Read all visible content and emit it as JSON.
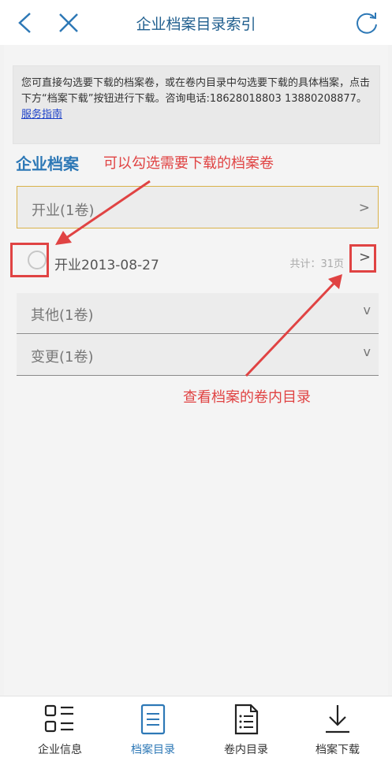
{
  "header": {
    "title": "企业档案目录索引"
  },
  "notice": {
    "text": "您可直接勾选要下载的档案卷，或在卷内目录中勾选要下载的具体档案，点击下方“档案下载”按钮进行下载。咨询电话:18628018803 13880208877。",
    "link": "服务指南"
  },
  "section": {
    "title": "企业档案"
  },
  "annotations": {
    "select_hint": "可以勾选需要下载的档案卷",
    "view_hint": "查看档案的卷内目录"
  },
  "groups": [
    {
      "label": "开业(1卷)",
      "arrow": ">"
    },
    {
      "label": "其他(1卷)",
      "arrow": "v"
    },
    {
      "label": "变更(1卷)",
      "arrow": "v"
    }
  ],
  "item": {
    "label": "开业2013-08-27",
    "pages": "共计：31页",
    "detail": ">"
  },
  "tabs": [
    {
      "label": "企业信息",
      "icon": "list-icon"
    },
    {
      "label": "档案目录",
      "icon": "document-icon",
      "active_color": "#2d78b6"
    },
    {
      "label": "卷内目录",
      "icon": "file-list-icon"
    },
    {
      "label": "档案下载",
      "icon": "download-icon"
    }
  ],
  "colors": {
    "accent": "#2d78b6",
    "annotation": "#e04343",
    "highlight_border": "#d9b24a"
  }
}
